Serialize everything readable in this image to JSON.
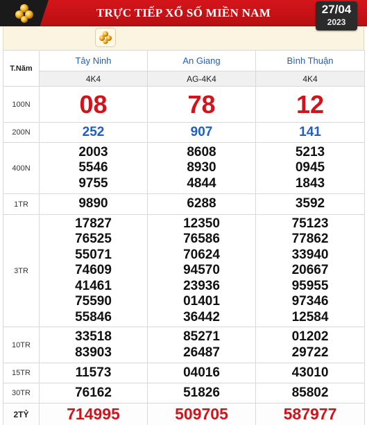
{
  "header": {
    "title": "TRỰC TIẾP XỔ SỐ MIỀN NAM",
    "date": "27/04",
    "year": "2023"
  },
  "table": {
    "corner_label": "T.Năm",
    "provinces": [
      {
        "name": "Tây Ninh",
        "code": "4K4"
      },
      {
        "name": "An Giang",
        "code": "AG-4K4"
      },
      {
        "name": "Bình Thuận",
        "code": "4K4"
      }
    ],
    "prizes": [
      {
        "label": "100N",
        "values": [
          [
            "08"
          ],
          [
            "78"
          ],
          [
            "12"
          ]
        ]
      },
      {
        "label": "200N",
        "values": [
          [
            "252"
          ],
          [
            "907"
          ],
          [
            "141"
          ]
        ]
      },
      {
        "label": "400N",
        "values": [
          [
            "2003",
            "5546",
            "9755"
          ],
          [
            "8608",
            "8930",
            "4844"
          ],
          [
            "5213",
            "0945",
            "1843"
          ]
        ]
      },
      {
        "label": "1TR",
        "values": [
          [
            "9890"
          ],
          [
            "6288"
          ],
          [
            "3592"
          ]
        ]
      },
      {
        "label": "3TR",
        "values": [
          [
            "17827",
            "76525",
            "55071",
            "74609",
            "41461",
            "75590",
            "55846"
          ],
          [
            "12350",
            "76586",
            "70624",
            "94570",
            "23936",
            "01401",
            "36442"
          ],
          [
            "75123",
            "77862",
            "33940",
            "20667",
            "95955",
            "97346",
            "12584"
          ]
        ]
      },
      {
        "label": "10TR",
        "values": [
          [
            "33518",
            "83903"
          ],
          [
            "85271",
            "26487"
          ],
          [
            "01202",
            "29722"
          ]
        ]
      },
      {
        "label": "15TR",
        "values": [
          [
            "11573"
          ],
          [
            "04016"
          ],
          [
            "43010"
          ]
        ]
      },
      {
        "label": "30TR",
        "values": [
          [
            "76162"
          ],
          [
            "51826"
          ],
          [
            "85802"
          ]
        ]
      },
      {
        "label": "2TỶ",
        "values": [
          [
            "714995"
          ],
          [
            "509705"
          ],
          [
            "587977"
          ]
        ]
      }
    ]
  },
  "colors": {
    "header_red": "#c8121a",
    "province_blue": "#1e5fbf",
    "number_red": "#d1141b",
    "code_row_bg": "#f0f0f0",
    "subbar_bg": "#fbf4e1"
  },
  "icons": {
    "logo": "lottery-balls-logo-icon",
    "mini_logo": "lottery-balls-mini-icon"
  }
}
